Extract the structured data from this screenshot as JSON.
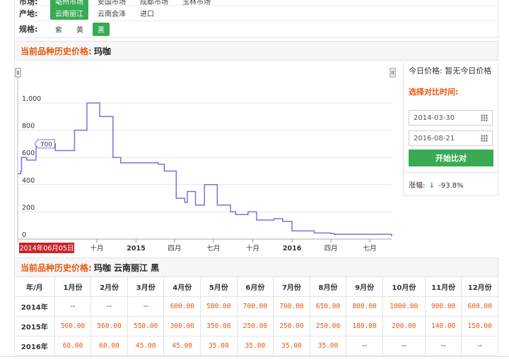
{
  "filters": {
    "market": {
      "label": "市场:",
      "options": [
        "亳州市场",
        "安国市场",
        "成都市场",
        "玉林市场"
      ],
      "active": 0
    },
    "origin": {
      "label": "产地:",
      "options": [
        "云南丽江",
        "云南会泽",
        "进口"
      ],
      "active": 0
    },
    "spec": {
      "label": "规格:",
      "options": [
        "紫",
        "黄",
        "黑"
      ],
      "active": 2
    }
  },
  "history": {
    "title": "当前品种历史价格:",
    "variety": "玛咖"
  },
  "side": {
    "today_label": "今日价格:",
    "today_value": "暂无今日价格",
    "compare_label": "选择对比时间:",
    "date_start": "2014-03-30",
    "date_end": "2016-08-21",
    "button": "开始比对",
    "change_label": "涨幅:",
    "change_arrow": "↓",
    "change_value": "-93.8%",
    "icon": "calendar-icon"
  },
  "chart_data": {
    "type": "line",
    "y_ticks": [
      "0",
      "200",
      "400",
      "600",
      "800",
      "1,000"
    ],
    "ylim": [
      0,
      1100
    ],
    "x_ticks": [
      "十月",
      "2015",
      "四月",
      "七月",
      "十月",
      "2016",
      "四月",
      "七月"
    ],
    "tooltip_value": "700",
    "date_badge": "2014年06月05日",
    "line_color": "#7a70e3",
    "series": [
      {
        "values": [
          [
            "2014-03-30",
            480
          ],
          [
            "2014-04-06",
            500
          ],
          [
            "2014-04-08",
            600
          ],
          [
            "2014-04-20",
            580
          ],
          [
            "2014-05-12",
            700
          ],
          [
            "2014-06-10",
            700
          ],
          [
            "2014-06-26",
            650
          ],
          [
            "2014-08-10",
            800
          ],
          [
            "2014-09-08",
            1000
          ],
          [
            "2014-10-08",
            900
          ],
          [
            "2014-11-08",
            600
          ],
          [
            "2014-11-26",
            560
          ],
          [
            "2015-02-10",
            560
          ],
          [
            "2015-02-22",
            550
          ],
          [
            "2015-03-08",
            500
          ],
          [
            "2015-04-05",
            300
          ],
          [
            "2015-04-25",
            270
          ],
          [
            "2015-05-01",
            350
          ],
          [
            "2015-05-20",
            250
          ],
          [
            "2015-06-10",
            400
          ],
          [
            "2015-07-10",
            250
          ],
          [
            "2015-08-10",
            200
          ],
          [
            "2015-08-22",
            180
          ],
          [
            "2015-09-20",
            200
          ],
          [
            "2015-10-10",
            140
          ],
          [
            "2015-11-20",
            150
          ],
          [
            "2015-12-10",
            130
          ],
          [
            "2016-01-01",
            60
          ],
          [
            "2016-02-22",
            45
          ],
          [
            "2016-04-01",
            40
          ],
          [
            "2016-04-10",
            35
          ],
          [
            "2016-08-15",
            35
          ],
          [
            "2016-08-21",
            20
          ]
        ]
      }
    ]
  },
  "table": {
    "title": "当前品种历史价格:",
    "subtitle": "玛咖  云南丽江  黑",
    "headers": [
      "年/月",
      "1月份",
      "2月份",
      "3月份",
      "4月份",
      "5月份",
      "6月份",
      "7月份",
      "8月份",
      "9月份",
      "10月份",
      "11月份",
      "12月份"
    ],
    "rows": [
      [
        "2014年",
        "--",
        "--",
        "--",
        "600.00",
        "580.00",
        "700.00",
        "700.00",
        "650.00",
        "800.00",
        "1000.00",
        "900.00",
        "600.00"
      ],
      [
        "2015年",
        "560.00",
        "560.00",
        "550.00",
        "300.00",
        "350.00",
        "250.00",
        "250.00",
        "250.00",
        "180.00",
        "200.00",
        "140.00",
        "150.00"
      ],
      [
        "2016年",
        "60.00",
        "60.00",
        "45.00",
        "45.00",
        "35.00",
        "35.00",
        "35.00",
        "35.00",
        "--",
        "--",
        "--",
        "--"
      ]
    ]
  }
}
